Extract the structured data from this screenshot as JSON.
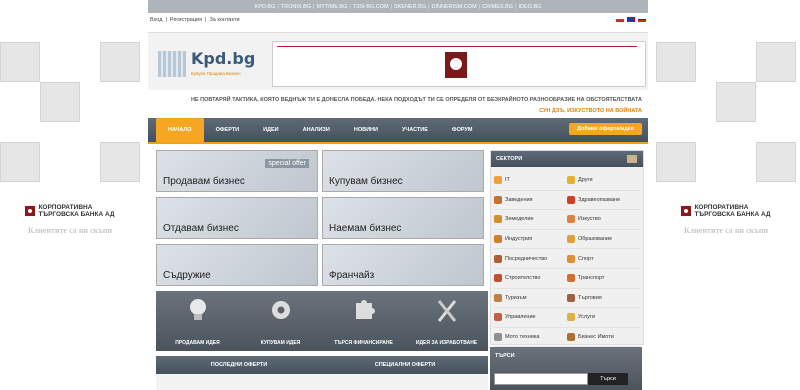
{
  "top_links": [
    "KPD.BG",
    "TRONIX.BG",
    "MYTIME.BG",
    "T3SI-BG.COM",
    "SKENER.BG",
    "DINNERISM.COM",
    "CRIMES.BG",
    "IDEO.BG"
  ],
  "login": {
    "enter": "Вход",
    "register": "Регистрация",
    "contact": "За контакти"
  },
  "logo": {
    "name": "Kpd.bg",
    "tagline": "Купува Продава Бизнес"
  },
  "quote": {
    "text": "НЕ ПОВТАРЯЙ ТАКТИКА, КОЯТО ВЕДНЪЖ ТИ Е ДОНЕСЛА ПОБЕДА. НЕКА ПОДХОДЪТ ТИ СЕ ОПРЕДЕЛЯ ОТ БЕЗКРАЙНОТО РАЗНООБРАЗИЕ НА ОБСТОЯТЕЛСТВАТА",
    "author": "СУН ДЗЪ, ИЗКУСТВОТО НА ВОЙНАТА"
  },
  "nav": [
    "НАЧАЛО",
    "ОФЕРТИ",
    "ИДЕИ",
    "АНАЛИЗИ",
    "НОВИНИ",
    "УЧАСТИЕ",
    "ФОРУМ"
  ],
  "add_offer": "Добави оферта/идея",
  "tiles": [
    "Продавам бизнес",
    "Купувам бизнес",
    "Отдавам бизнес",
    "Наемам бизнес",
    "Съдружие",
    "Франчайз"
  ],
  "special_offer": "special offer",
  "ideas": [
    "ПРОДАВАМ ИДЕЯ",
    "КУПУВАМ ИДЕЯ",
    "ТЪРСЯ ФИНАНСИРАНЕ",
    "ИДЕЯ ЗА ИЗРАБОТВАНЕ"
  ],
  "lists": [
    "ПОСЛЕДНИ ОФЕРТИ",
    "СПЕЦИАЛНИ ОФЕРТИ"
  ],
  "sectors_title": "СЕКТОРИ",
  "sectors": [
    "IT",
    "Други",
    "Заведения",
    "Здравеопазване",
    "Земеделие",
    "Изкуство",
    "Индустрия",
    "Образование",
    "Посредничество",
    "Спорт",
    "Строителство",
    "Транспорт",
    "Туризъм",
    "Търговия",
    "Управление",
    "Услуги",
    "Мото техника",
    "Бизнес Имоти"
  ],
  "search": {
    "title": "ТЪРСИ",
    "button": "Търси"
  },
  "bank": {
    "name1": "КОРПОРАТИВНА",
    "name2": "ТЪРГОВСКА БАНКА АД",
    "slogan": "Клиентите са ни скъпи"
  },
  "colors": {
    "accent": "#f5a623",
    "nav": "#4b5660",
    "bank": "#8b1a1a"
  }
}
